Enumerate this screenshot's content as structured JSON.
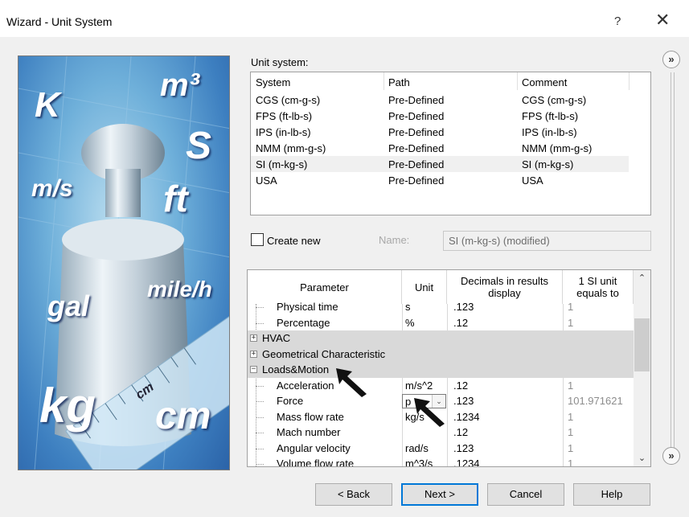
{
  "window": {
    "title": "Wizard - Unit System",
    "help_glyph": "?",
    "close_glyph": "✕"
  },
  "hero": {
    "words": [
      "K",
      "m³",
      "S",
      "m/s",
      "ft",
      "gal",
      "mile/h",
      "kg",
      "cm",
      "cm"
    ]
  },
  "unit_system": {
    "label": "Unit system:",
    "columns": [
      "System",
      "Path",
      "Comment"
    ],
    "rows": [
      {
        "system": "CGS (cm-g-s)",
        "path": "Pre-Defined",
        "comment": "CGS (cm-g-s)"
      },
      {
        "system": "FPS (ft-lb-s)",
        "path": "Pre-Defined",
        "comment": "FPS (ft-lb-s)"
      },
      {
        "system": "IPS (in-lb-s)",
        "path": "Pre-Defined",
        "comment": "IPS (in-lb-s)"
      },
      {
        "system": "NMM (mm-g-s)",
        "path": "Pre-Defined",
        "comment": "NMM (mm-g-s)"
      },
      {
        "system": "SI (m-kg-s)",
        "path": "Pre-Defined",
        "comment": "SI (m-kg-s)"
      },
      {
        "system": "USA",
        "path": "Pre-Defined",
        "comment": "USA"
      }
    ],
    "selected_index": 4
  },
  "create_new": {
    "label": "Create new",
    "name_label": "Name:",
    "name_value": "SI (m-kg-s) (modified)"
  },
  "params": {
    "headers": {
      "parameter": "Parameter",
      "unit": "Unit",
      "decimals": "Decimals in results display",
      "equals": "1 SI unit equals to"
    },
    "rows": [
      {
        "name": "Physical time",
        "unit": "s",
        "decimals": ".123",
        "equals": "1",
        "kind": "child"
      },
      {
        "name": "Percentage",
        "unit": "%",
        "decimals": ".12",
        "equals": "1",
        "kind": "child"
      },
      {
        "name": "HVAC",
        "unit": "",
        "decimals": "",
        "equals": "",
        "kind": "group",
        "expander": "+"
      },
      {
        "name": "Geometrical Characteristic",
        "unit": "",
        "decimals": "",
        "equals": "",
        "kind": "group",
        "expander": "+"
      },
      {
        "name": "Loads&Motion",
        "unit": "",
        "decimals": "",
        "equals": "",
        "kind": "group",
        "expander": "−"
      },
      {
        "name": "Acceleration",
        "unit": "m/s^2",
        "decimals": ".12",
        "equals": "1",
        "kind": "child"
      },
      {
        "name": "Force",
        "unit": "p",
        "decimals": ".123",
        "equals": "101.971621",
        "kind": "child",
        "dropdown": true
      },
      {
        "name": "Mass flow rate",
        "unit": "kg/s",
        "decimals": ".1234",
        "equals": "1",
        "kind": "child"
      },
      {
        "name": "Mach number",
        "unit": "",
        "decimals": ".12",
        "equals": "1",
        "kind": "child"
      },
      {
        "name": "Angular velocity",
        "unit": "rad/s",
        "decimals": ".123",
        "equals": "1",
        "kind": "child"
      },
      {
        "name": "Volume flow rate",
        "unit": "m^3/s",
        "decimals": ".1234",
        "equals": "1",
        "kind": "child"
      }
    ]
  },
  "buttons": {
    "back": "< Back",
    "next": "Next >",
    "cancel": "Cancel",
    "help": "Help"
  },
  "colors": {
    "accent": "#0078d7",
    "group_row": "#d9d9d9"
  }
}
